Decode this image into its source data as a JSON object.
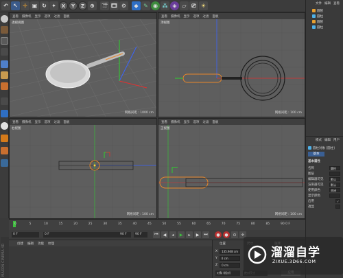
{
  "viewports": {
    "perspective": {
      "label": "透视视图",
      "menu": [
        "查看",
        "摄像机",
        "显示",
        "选项",
        "过滤",
        "面板"
      ],
      "footer": "网格间距 : 1000 cm"
    },
    "top": {
      "label": "顶视图",
      "menu": [
        "查看",
        "摄像机",
        "显示",
        "选项",
        "过滤",
        "面板"
      ],
      "footer": "网格间距 : 100 cm"
    },
    "right": {
      "label": "右视图",
      "menu": [
        "查看",
        "摄像机",
        "显示",
        "选项",
        "过滤",
        "面板"
      ],
      "footer": "网格间距 : 100 cm"
    },
    "front": {
      "label": "正视图",
      "menu": [
        "查看",
        "摄像机",
        "显示",
        "选项",
        "过滤",
        "面板"
      ],
      "footer": "网格间距 : 100 cm"
    }
  },
  "toolbar": {
    "axis_x": "X",
    "axis_y": "Y",
    "axis_z": "Z"
  },
  "object_manager": {
    "menu": [
      "文件",
      "编辑",
      "查看"
    ],
    "objects": [
      {
        "name": "圆管",
        "color": "#e8a030"
      },
      {
        "name": "圆柱",
        "color": "#4fb1e8"
      },
      {
        "name": "圆管",
        "color": "#e8a030"
      },
      {
        "name": "圆柱",
        "color": "#4fb1e8"
      }
    ]
  },
  "attributes": {
    "menu": [
      "模式",
      "编辑",
      "用户"
    ],
    "title": "圆柱对象 [圆柱]",
    "tab": "基本",
    "section": "基本属性",
    "rows": [
      {
        "label": "名称",
        "value": "圆柱"
      },
      {
        "label": "图层",
        "value": ""
      },
      {
        "label": "编辑器可见",
        "value": "默认"
      },
      {
        "label": "渲染器可见",
        "value": "默认"
      },
      {
        "label": "使用颜色",
        "value": "关闭"
      },
      {
        "label": "显示颜色",
        "value": ""
      },
      {
        "label": "启用",
        "value": "✓"
      },
      {
        "label": "透显",
        "value": ""
      }
    ]
  },
  "timeline": {
    "ticks": [
      "0",
      "5",
      "10",
      "15",
      "20",
      "25",
      "30",
      "35",
      "40",
      "45",
      "50",
      "55",
      "60",
      "65",
      "70",
      "75",
      "80",
      "85",
      "90"
    ],
    "current_frame": "0 F",
    "start_field": "0 F",
    "end_field": "90 F",
    "end_field2": "90 F",
    "frame_label": "0 F"
  },
  "material_manager": {
    "menu": [
      "创建",
      "编辑",
      "功能",
      "纹理"
    ]
  },
  "coordinates": {
    "headers": [
      "位置",
      "尺寸",
      "旋转"
    ],
    "x": "135.948 cm",
    "y": "0 cm",
    "z": "0 cm",
    "h": "0°",
    "object_mode": "对象 (相对)",
    "size_mode": "绝对尺寸",
    "apply": "应用"
  },
  "watermark": {
    "title": "溜溜自学",
    "url": "ZIXUE.3D66.COM"
  },
  "brand": "MAXON CINEMA 4D",
  "colors": {
    "selection": "#e8872a",
    "axis_x": "#e23030",
    "axis_y": "#2fd02f",
    "axis_z": "#3a64ff"
  }
}
